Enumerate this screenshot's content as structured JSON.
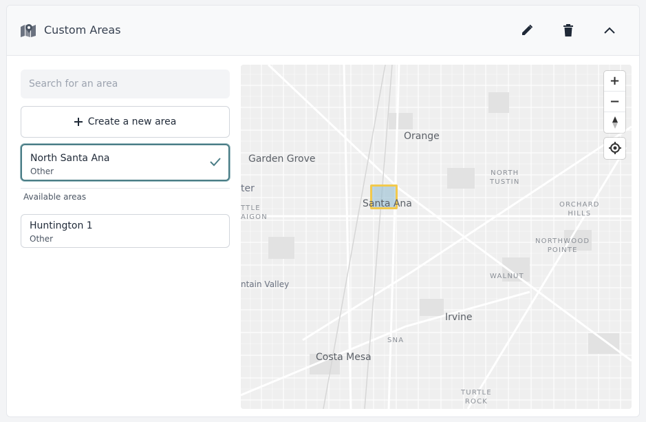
{
  "header": {
    "title": "Custom Areas",
    "icons": {
      "map_icon": "map-pin-icon",
      "edit": "pencil-icon",
      "delete": "trash-icon",
      "collapse": "chevron-up-icon"
    }
  },
  "sidebar": {
    "search_placeholder": "Search for an area",
    "search_value": "",
    "create_label": "Create a new area",
    "selected_area": {
      "name": "North Santa Ana",
      "type": "Other"
    },
    "available_label": "Available areas",
    "available": [
      {
        "name": "Huntington 1",
        "type": "Other"
      }
    ]
  },
  "map": {
    "labels": {
      "orange": "Orange",
      "garden_grove": "Garden Grove",
      "santa_ana": "Santa Ana",
      "north_tustin": "NORTH\nTUSTIN",
      "orchard_hills": "ORCHARD\nHILLS",
      "northwood": "NORTHWOOD\nPOINTE",
      "walnut": "WALNUT",
      "irvine": "Irvine",
      "sna": "SNA",
      "costa_mesa": "Costa Mesa",
      "turtle_rock": "TURTLE\nROCK",
      "fountain_valley": "ntain Valley",
      "little_saigon": "TTLE\nAIGON",
      "edge_ter": "ter"
    },
    "controls": {
      "zoom_in": "+",
      "zoom_out": "−"
    }
  },
  "colors": {
    "accent": "#4a7d86",
    "highlight_border": "#f2c94c"
  }
}
